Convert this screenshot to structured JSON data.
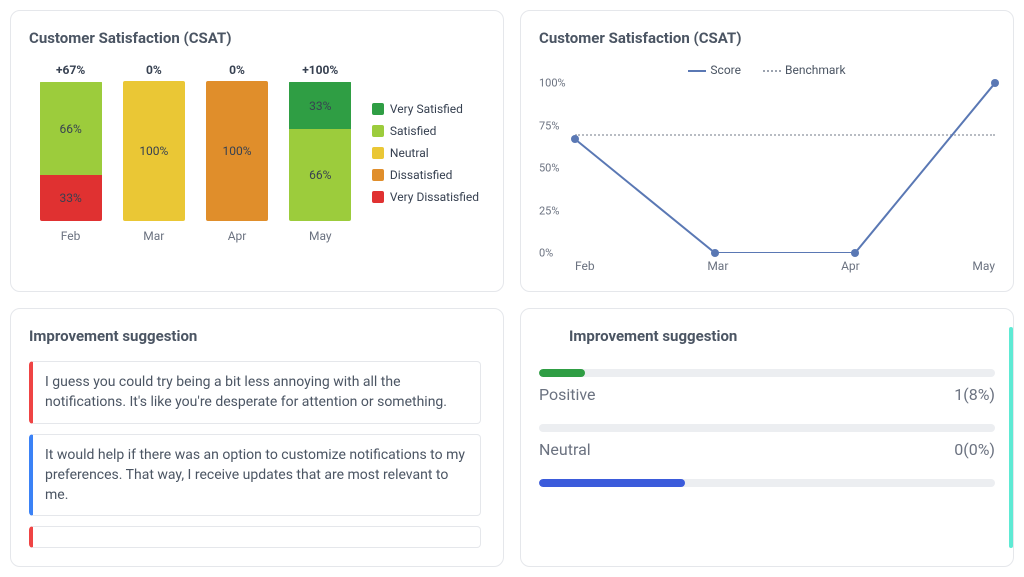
{
  "colors": {
    "very_satisfied": "#2f9e44",
    "satisfied": "#9ccc3c",
    "neutral": "#eac735",
    "dissatisfied": "#e08e2b",
    "very_dissatisfied": "#e03131",
    "line": "#5a78b4",
    "positive": "#2f9e44",
    "neutral_bar": "#9ca3af",
    "neg_bar": "#3b5bdb"
  },
  "csat_bar": {
    "title": "Customer Satisfaction (CSAT)",
    "legend": [
      "Very Satisfied",
      "Satisfied",
      "Neutral",
      "Dissatisfied",
      "Very Dissatisfied"
    ],
    "months": [
      "Feb",
      "Mar",
      "Apr",
      "May"
    ],
    "top": [
      "+67%",
      "0%",
      "0%",
      "+100%"
    ],
    "stacks": [
      [
        {
          "k": "very_dissatisfied",
          "v": 33,
          "lbl": "33%"
        },
        {
          "k": "satisfied",
          "v": 66,
          "lbl": "66%"
        }
      ],
      [
        {
          "k": "neutral",
          "v": 100,
          "lbl": "100%"
        }
      ],
      [
        {
          "k": "dissatisfied",
          "v": 100,
          "lbl": "100%"
        }
      ],
      [
        {
          "k": "satisfied",
          "v": 66,
          "lbl": "66%"
        },
        {
          "k": "very_satisfied",
          "v": 33,
          "lbl": "33%"
        }
      ]
    ]
  },
  "csat_line": {
    "title": "Customer Satisfaction (CSAT)",
    "series_labels": {
      "score": "Score",
      "benchmark": "Benchmark"
    },
    "yticks": [
      "0%",
      "25%",
      "50%",
      "75%",
      "100%"
    ],
    "months": [
      "Feb",
      "Mar",
      "Apr",
      "May"
    ],
    "score": [
      67,
      0,
      0,
      100
    ],
    "benchmark": 70
  },
  "sugg": {
    "title": "Improvement suggestion",
    "items": [
      {
        "sent": "red",
        "text": "I guess you could try being a bit less annoying with all the notifications. It's like you're desperate for attention or something."
      },
      {
        "sent": "blue",
        "text": "It would help if there was an option to customize notifications to my preferences. That way, I receive updates that are most relevant to me."
      },
      {
        "sent": "red",
        "text": ""
      }
    ]
  },
  "sent": {
    "title": "Improvement suggestion",
    "rows": [
      {
        "label": "Positive",
        "count": 1,
        "pct": "8%",
        "fill": 10,
        "color": "positive"
      },
      {
        "label": "Neutral",
        "count": 0,
        "pct": "0%",
        "fill": 0,
        "color": "neutral_bar"
      },
      {
        "label": "",
        "count": "",
        "pct": "",
        "fill": 32,
        "color": "neg_bar"
      }
    ]
  },
  "chart_data": [
    {
      "type": "bar",
      "title": "Customer Satisfaction (CSAT)",
      "stacked": true,
      "categories": [
        "Feb",
        "Mar",
        "Apr",
        "May"
      ],
      "series": [
        {
          "name": "Very Satisfied",
          "values": [
            0,
            0,
            0,
            33
          ]
        },
        {
          "name": "Satisfied",
          "values": [
            66,
            0,
            0,
            66
          ]
        },
        {
          "name": "Neutral",
          "values": [
            0,
            100,
            0,
            0
          ]
        },
        {
          "name": "Dissatisfied",
          "values": [
            0,
            0,
            100,
            0
          ]
        },
        {
          "name": "Very Dissatisfied",
          "values": [
            33,
            0,
            0,
            0
          ]
        }
      ],
      "annotations_top": [
        "+67%",
        "0%",
        "0%",
        "+100%"
      ],
      "ylabel": "%"
    },
    {
      "type": "line",
      "title": "Customer Satisfaction (CSAT)",
      "categories": [
        "Feb",
        "Mar",
        "Apr",
        "May"
      ],
      "series": [
        {
          "name": "Score",
          "values": [
            67,
            0,
            0,
            100
          ]
        },
        {
          "name": "Benchmark",
          "values": [
            70,
            70,
            70,
            70
          ],
          "style": "dotted"
        }
      ],
      "ylabel": "%",
      "ylim": [
        0,
        100
      ]
    },
    {
      "type": "bar",
      "title": "Improvement suggestion",
      "orientation": "horizontal",
      "categories": [
        "Positive",
        "Neutral"
      ],
      "values": [
        8,
        0
      ],
      "counts": [
        1,
        0
      ],
      "ylabel": "%"
    }
  ]
}
